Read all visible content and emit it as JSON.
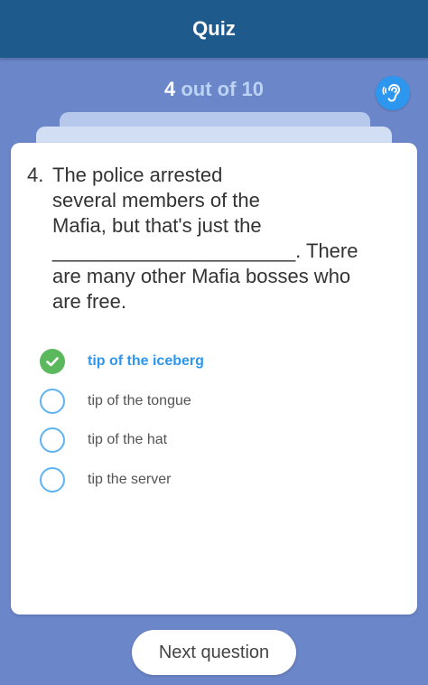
{
  "app": {
    "title": "Quiz"
  },
  "progress": {
    "current": "4",
    "suffix": "out of 10",
    "listen_icon": "ear-icon"
  },
  "question": {
    "number": "4.",
    "text": "The police arrested\nseveral members of the\nMafia, but that's just the\n______________________. There\nare many other Mafia bosses who\nare free."
  },
  "options": [
    {
      "label": "tip of the iceberg",
      "selected": true,
      "icon": "check-icon"
    },
    {
      "label": "tip of the tongue",
      "selected": false
    },
    {
      "label": "tip of the hat",
      "selected": false
    },
    {
      "label": "tip the server",
      "selected": false
    }
  ],
  "footer": {
    "next_label": "Next question"
  },
  "colors": {
    "appbar": "#1f5a8c",
    "background": "#6b86c9",
    "accent": "#2d96ef",
    "correct": "#5cb85c"
  }
}
